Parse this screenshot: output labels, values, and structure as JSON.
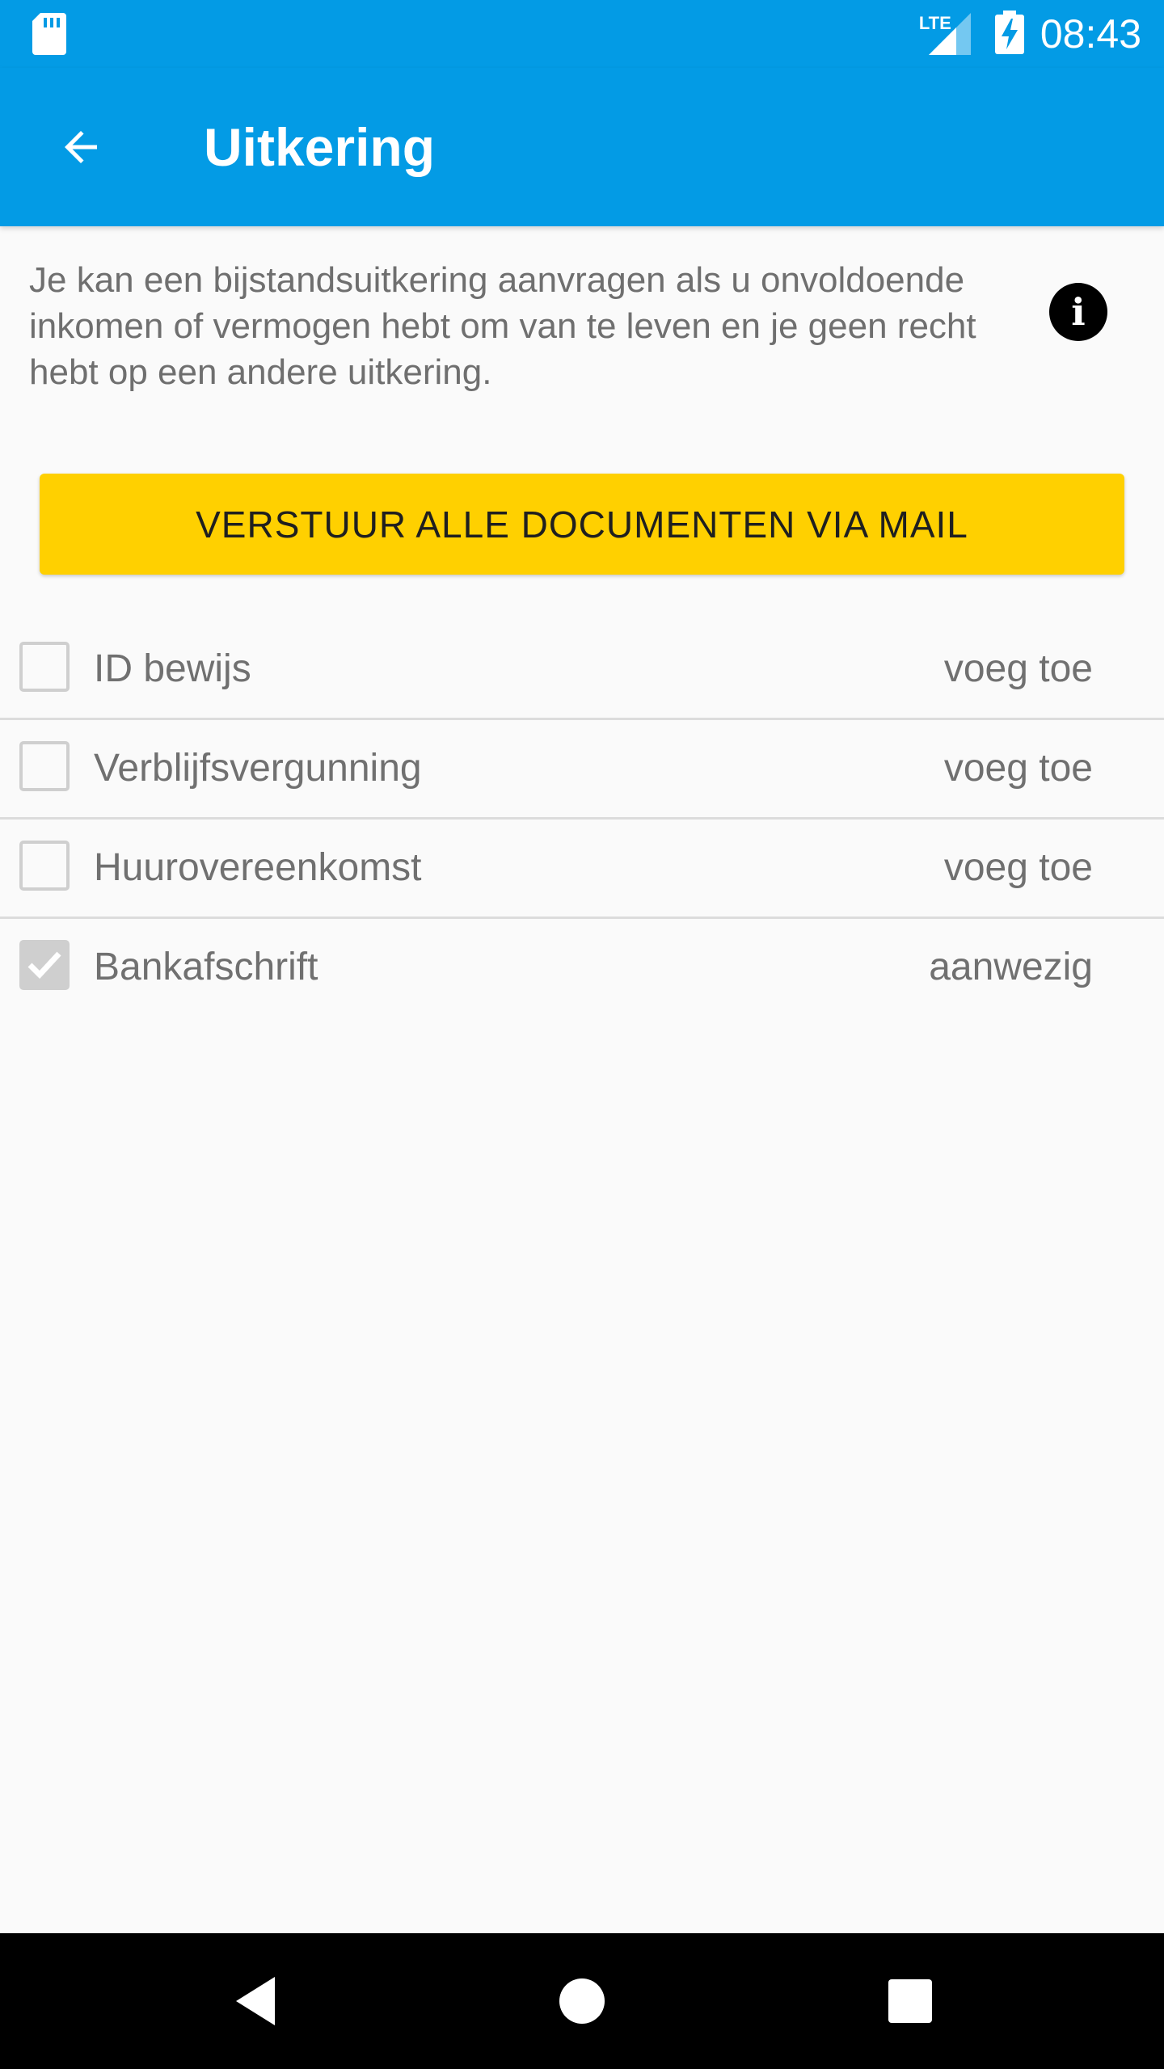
{
  "status_bar": {
    "network": "LTE",
    "time": "08:43",
    "icons": [
      "sd-card-icon",
      "signal-icon",
      "battery-charging-icon"
    ]
  },
  "app_bar": {
    "title": "Uitkering",
    "back_icon": "arrow-back-icon"
  },
  "intro": {
    "text": "Je kan een bijstandsuitkering aanvragen als u onvoldoende inkomen of vermogen hebt om van te leven en je geen recht hebt op een andere uitkering.",
    "info_icon": "info-icon"
  },
  "send_button": {
    "label": "VERSTUUR ALLE DOCUMENTEN VIA MAIL",
    "color": "#ffd000"
  },
  "documents": [
    {
      "label": "ID bewijs",
      "action": "voeg toe",
      "checked": false
    },
    {
      "label": "Verblijfsvergunning",
      "action": "voeg toe",
      "checked": false
    },
    {
      "label": "Huurovereenkomst",
      "action": "voeg toe",
      "checked": false
    },
    {
      "label": "Bankafschrift",
      "action": "aanwezig",
      "checked": true
    }
  ],
  "nav_bar": {
    "icons": [
      "nav-back-icon",
      "nav-home-icon",
      "nav-recents-icon"
    ]
  },
  "colors": {
    "primary": "#039be5",
    "accent": "#ffd000",
    "background": "#fafafa"
  }
}
